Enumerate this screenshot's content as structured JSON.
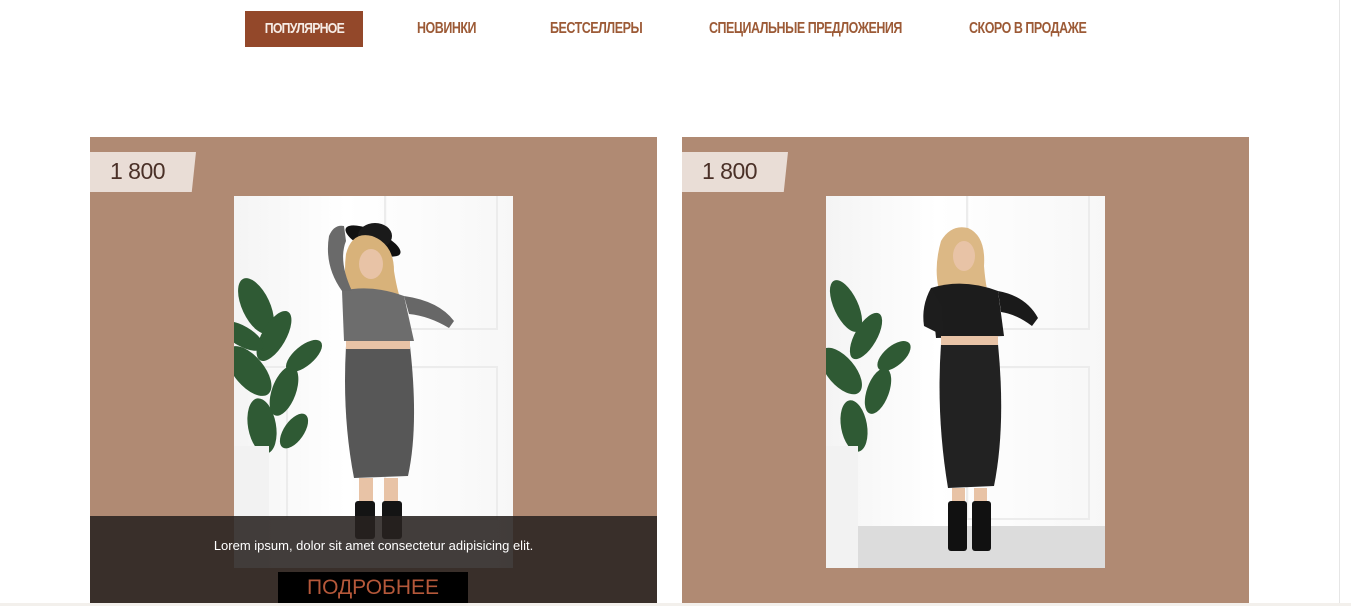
{
  "tabs": [
    {
      "label": "ПОПУЛЯРНОЕ",
      "active": true
    },
    {
      "label": "НОВИНКИ",
      "active": false
    },
    {
      "label": "БЕСТСЕЛЛЕРЫ",
      "active": false
    },
    {
      "label": "СПЕЦИАЛЬНЫЕ ПРЕДЛОЖЕНИЯ",
      "active": false
    },
    {
      "label": "СКОРО В ПРОДАЖЕ",
      "active": false
    }
  ],
  "products": [
    {
      "price": "1 800",
      "image": "model-grey-knit-set-with-hat",
      "overlay_visible": true,
      "description": "Lorem ipsum, dolor sit amet consectetur adipisicing elit.",
      "more_label": "ПОДРОБНЕЕ"
    },
    {
      "price": "1 800",
      "image": "model-black-knit-set",
      "overlay_visible": false
    }
  ],
  "colors": {
    "accent": "#93482a",
    "tab_text": "#9c5a36",
    "card_background": "#b08a73",
    "price_tag": "#e9ddd6",
    "overlay": "#282220",
    "button_text": "#b5583a"
  }
}
